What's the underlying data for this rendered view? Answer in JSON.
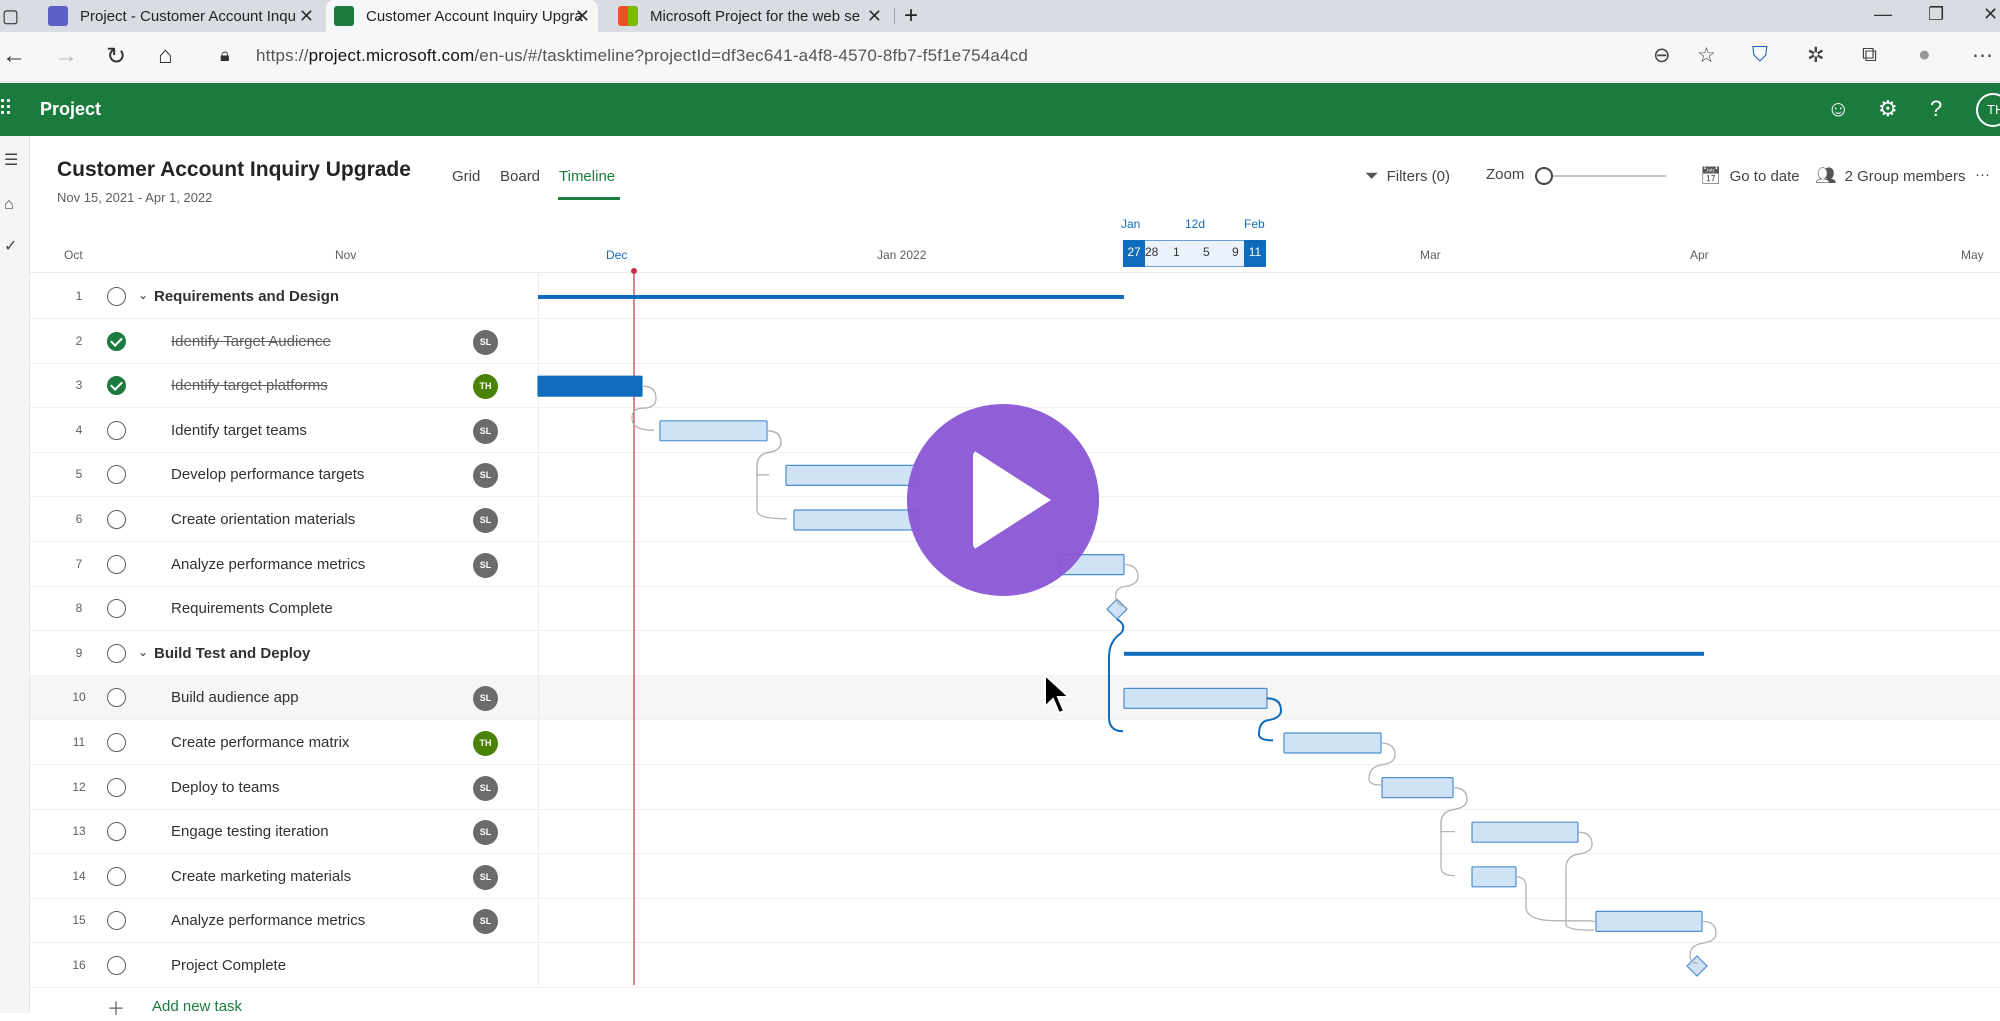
{
  "browser": {
    "tabs": [
      {
        "title": "Project - Customer Account Inqu",
        "active": false
      },
      {
        "title": "Customer Account Inquiry Upgra",
        "active": true
      },
      {
        "title": "Microsoft Project for the web se",
        "active": false
      }
    ],
    "new_tab": "+",
    "url_prefix": "https://",
    "url_host": "project.microsoft.com",
    "url_rest": "/en-us/#/tasktimeline?projectId=df3ec641-a4f8-4570-8fb7-f5f1e754a4cd"
  },
  "app": {
    "name": "Project",
    "user_initials": "TH"
  },
  "project": {
    "title": "Customer Account Inquiry Upgrade",
    "dates": "Nov 15, 2021 - Apr 1, 2022"
  },
  "views": [
    "Grid",
    "Board",
    "Timeline"
  ],
  "active_view": "Timeline",
  "commands": {
    "filters": "Filters (0)",
    "zoom": "Zoom",
    "go_to_date": "Go to date",
    "group_members": "2 Group members",
    "more": "···"
  },
  "timeline_scale": [
    "Oct",
    "Nov",
    "Dec",
    "Jan 2022",
    "Mar",
    "Apr",
    "May"
  ],
  "range_picker": {
    "top_labels": [
      "Jan",
      "12d",
      "Feb"
    ],
    "days": [
      "27",
      "28",
      "1",
      "5",
      "9",
      "11"
    ]
  },
  "tasks": [
    {
      "num": "1",
      "name": "Requirements and Design",
      "summary": true,
      "done": false,
      "assignee": ""
    },
    {
      "num": "2",
      "name": "Identify Target Audience",
      "summary": false,
      "done": true,
      "assignee": "SL"
    },
    {
      "num": "3",
      "name": "Identify target platforms",
      "summary": false,
      "done": true,
      "assignee": "TH"
    },
    {
      "num": "4",
      "name": "Identify target teams",
      "summary": false,
      "done": false,
      "assignee": "SL"
    },
    {
      "num": "5",
      "name": "Develop performance targets",
      "summary": false,
      "done": false,
      "assignee": "SL"
    },
    {
      "num": "6",
      "name": "Create orientation materials",
      "summary": false,
      "done": false,
      "assignee": "SL"
    },
    {
      "num": "7",
      "name": "Analyze performance metrics",
      "summary": false,
      "done": false,
      "assignee": "SL"
    },
    {
      "num": "8",
      "name": "Requirements Complete",
      "summary": false,
      "done": false,
      "assignee": ""
    },
    {
      "num": "9",
      "name": "Build Test and Deploy",
      "summary": true,
      "done": false,
      "assignee": ""
    },
    {
      "num": "10",
      "name": "Build audience app",
      "summary": false,
      "done": false,
      "assignee": "SL"
    },
    {
      "num": "11",
      "name": "Create performance matrix",
      "summary": false,
      "done": false,
      "assignee": "TH"
    },
    {
      "num": "12",
      "name": "Deploy to teams",
      "summary": false,
      "done": false,
      "assignee": "SL"
    },
    {
      "num": "13",
      "name": "Engage testing iteration",
      "summary": false,
      "done": false,
      "assignee": "SL"
    },
    {
      "num": "14",
      "name": "Create marketing materials",
      "summary": false,
      "done": false,
      "assignee": "SL"
    },
    {
      "num": "15",
      "name": "Analyze performance metrics",
      "summary": false,
      "done": false,
      "assignee": "SL"
    },
    {
      "num": "16",
      "name": "Project Complete",
      "summary": false,
      "done": false,
      "assignee": ""
    }
  ],
  "add_task_label": "Add new task",
  "colors": {
    "brand": "#1b7a3d",
    "accent_blue": "#0f6cbd",
    "bar_fill": "#cfe2f6",
    "bar_border": "#4e8fd0",
    "today_line": "#c4314b",
    "avatar_SL": "#6b6b6b",
    "avatar_TH": "#498205",
    "play_button": "#8b57d6"
  }
}
